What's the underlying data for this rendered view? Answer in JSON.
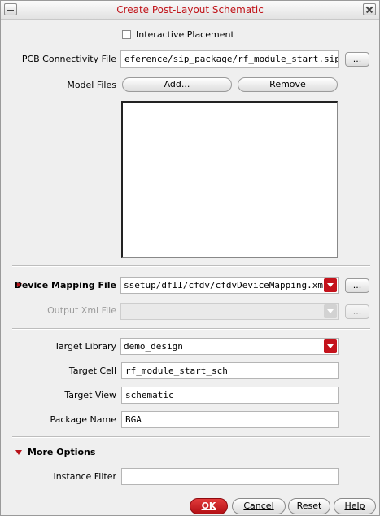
{
  "window": {
    "title": "Create Post-Layout Schematic"
  },
  "interactive_placement": {
    "label": "Interactive Placement",
    "checked": false
  },
  "pcb_connectivity": {
    "label": "PCB Connectivity File",
    "value": "eference/sip_package/rf_module_start.sip",
    "browse": "..."
  },
  "model_files": {
    "label": "Model Files",
    "add": "Add...",
    "remove": "Remove",
    "items": []
  },
  "device_mapping": {
    "label": "Device Mapping File",
    "value": "ssetup/dfII/cfdv/cfdvDeviceMapping.xml",
    "browse": "..."
  },
  "output_xml": {
    "label": "Output Xml File",
    "value": "",
    "browse": "..."
  },
  "target_library": {
    "label": "Target Library",
    "value": "demo_design"
  },
  "target_cell": {
    "label": "Target Cell",
    "value": "rf_module_start_sch"
  },
  "target_view": {
    "label": "Target View",
    "value": "schematic"
  },
  "package_name": {
    "label": "Package Name",
    "value": "BGA"
  },
  "more_options": {
    "label": "More Options"
  },
  "instance_filter": {
    "label": "Instance Filter",
    "value": ""
  },
  "buttons": {
    "ok": "OK",
    "cancel": "Cancel",
    "reset": "Reset",
    "help": "Help"
  },
  "colors": {
    "accent": "#c0141a"
  }
}
